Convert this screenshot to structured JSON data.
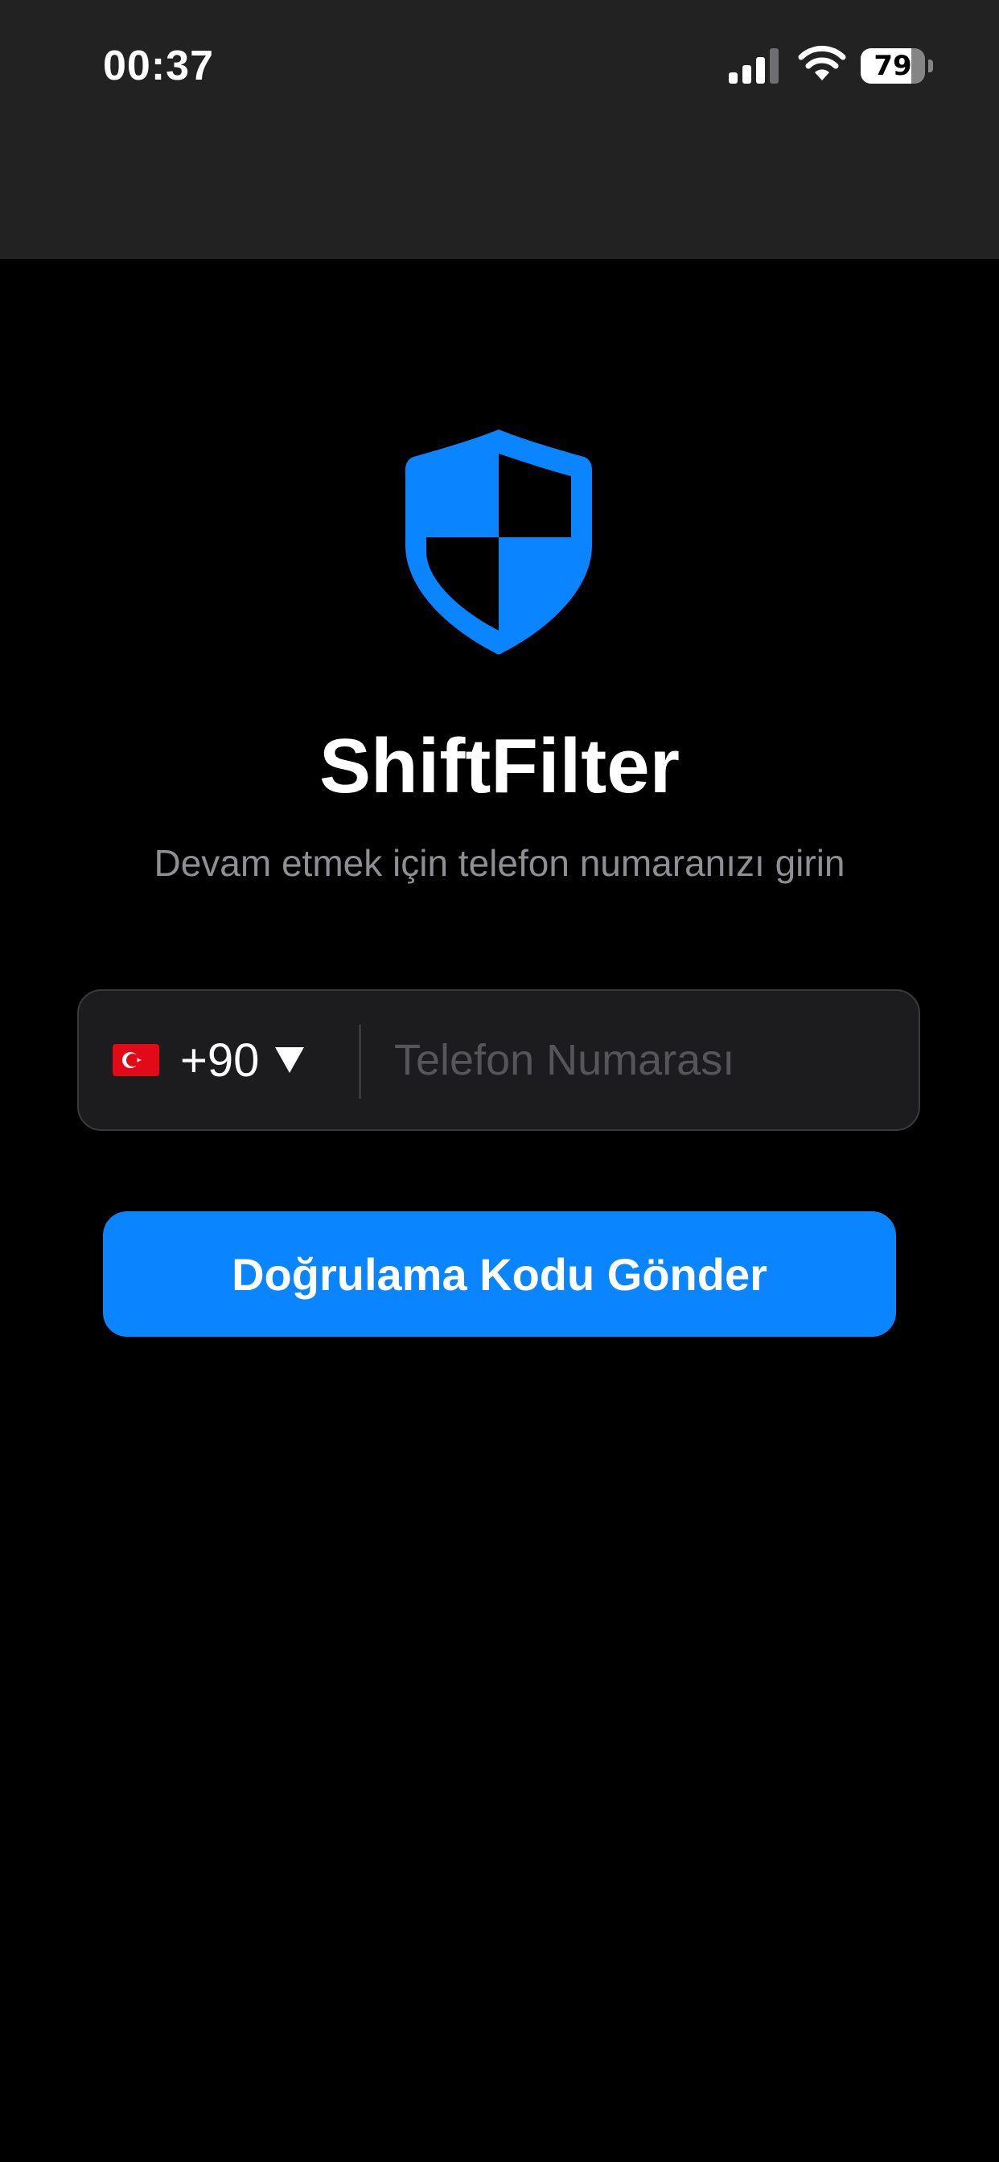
{
  "status_bar": {
    "time": "00:37",
    "battery_level": "79",
    "battery_fraction": 0.79,
    "signal_icon": "cellular-signal-icon",
    "wifi_icon": "wifi-icon",
    "battery_icon": "battery-icon"
  },
  "app": {
    "logo_icon": "shield-icon",
    "title": "ShiftFilter",
    "subtitle": "Devam etmek için telefon numaranızı girin"
  },
  "phone_form": {
    "country_flag": "turkey-flag-icon",
    "dial_code": "+90",
    "dropdown_icon": "chevron-down-icon",
    "phone_value": "",
    "phone_placeholder": "Telefon Numarası"
  },
  "actions": {
    "send_code_label": "Doğrulama Kodu Gönder"
  },
  "colors": {
    "accent": "#0a84ff",
    "background": "#000000",
    "status_bar_background": "#222222",
    "field_background": "#1c1c1e",
    "field_border": "#3a3a3c",
    "subtitle_text": "#8e8e93"
  }
}
